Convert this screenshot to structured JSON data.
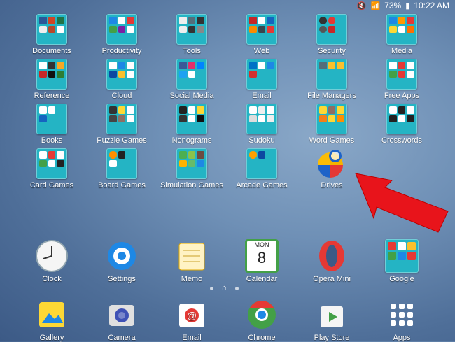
{
  "status_bar": {
    "battery": "73%",
    "time": "10:22 AM"
  },
  "folders": [
    {
      "label": "Documents"
    },
    {
      "label": "Productivity"
    },
    {
      "label": "Tools"
    },
    {
      "label": "Web"
    },
    {
      "label": "Security"
    },
    {
      "label": "Media"
    },
    {
      "label": "Reference"
    },
    {
      "label": "Cloud"
    },
    {
      "label": "Social Media"
    },
    {
      "label": "Email"
    },
    {
      "label": "File Managers"
    },
    {
      "label": "Free Apps"
    },
    {
      "label": "Books"
    },
    {
      "label": "Puzzle Games"
    },
    {
      "label": "Nonograms"
    },
    {
      "label": "Sudoku"
    },
    {
      "label": "Word Games"
    },
    {
      "label": "Crosswords"
    },
    {
      "label": "Card Games"
    },
    {
      "label": "Board Games"
    },
    {
      "label": "Simulation Games"
    },
    {
      "label": "Arcade Games"
    }
  ],
  "drives": {
    "label": "Drives"
  },
  "favorites": [
    {
      "label": "Clock"
    },
    {
      "label": "Settings"
    },
    {
      "label": "Memo"
    },
    {
      "label": "Calendar"
    },
    {
      "label": "Opera Mini"
    },
    {
      "label": "Google"
    }
  ],
  "calendar_icon": {
    "month": "MON",
    "day": "8"
  },
  "dock": [
    {
      "label": "Gallery"
    },
    {
      "label": "Camera"
    },
    {
      "label": "Email"
    },
    {
      "label": "Chrome"
    },
    {
      "label": "Play Store"
    },
    {
      "label": "Apps"
    }
  ],
  "colors": {
    "folder": "#24b4c4",
    "arrow": "#e8141b"
  }
}
